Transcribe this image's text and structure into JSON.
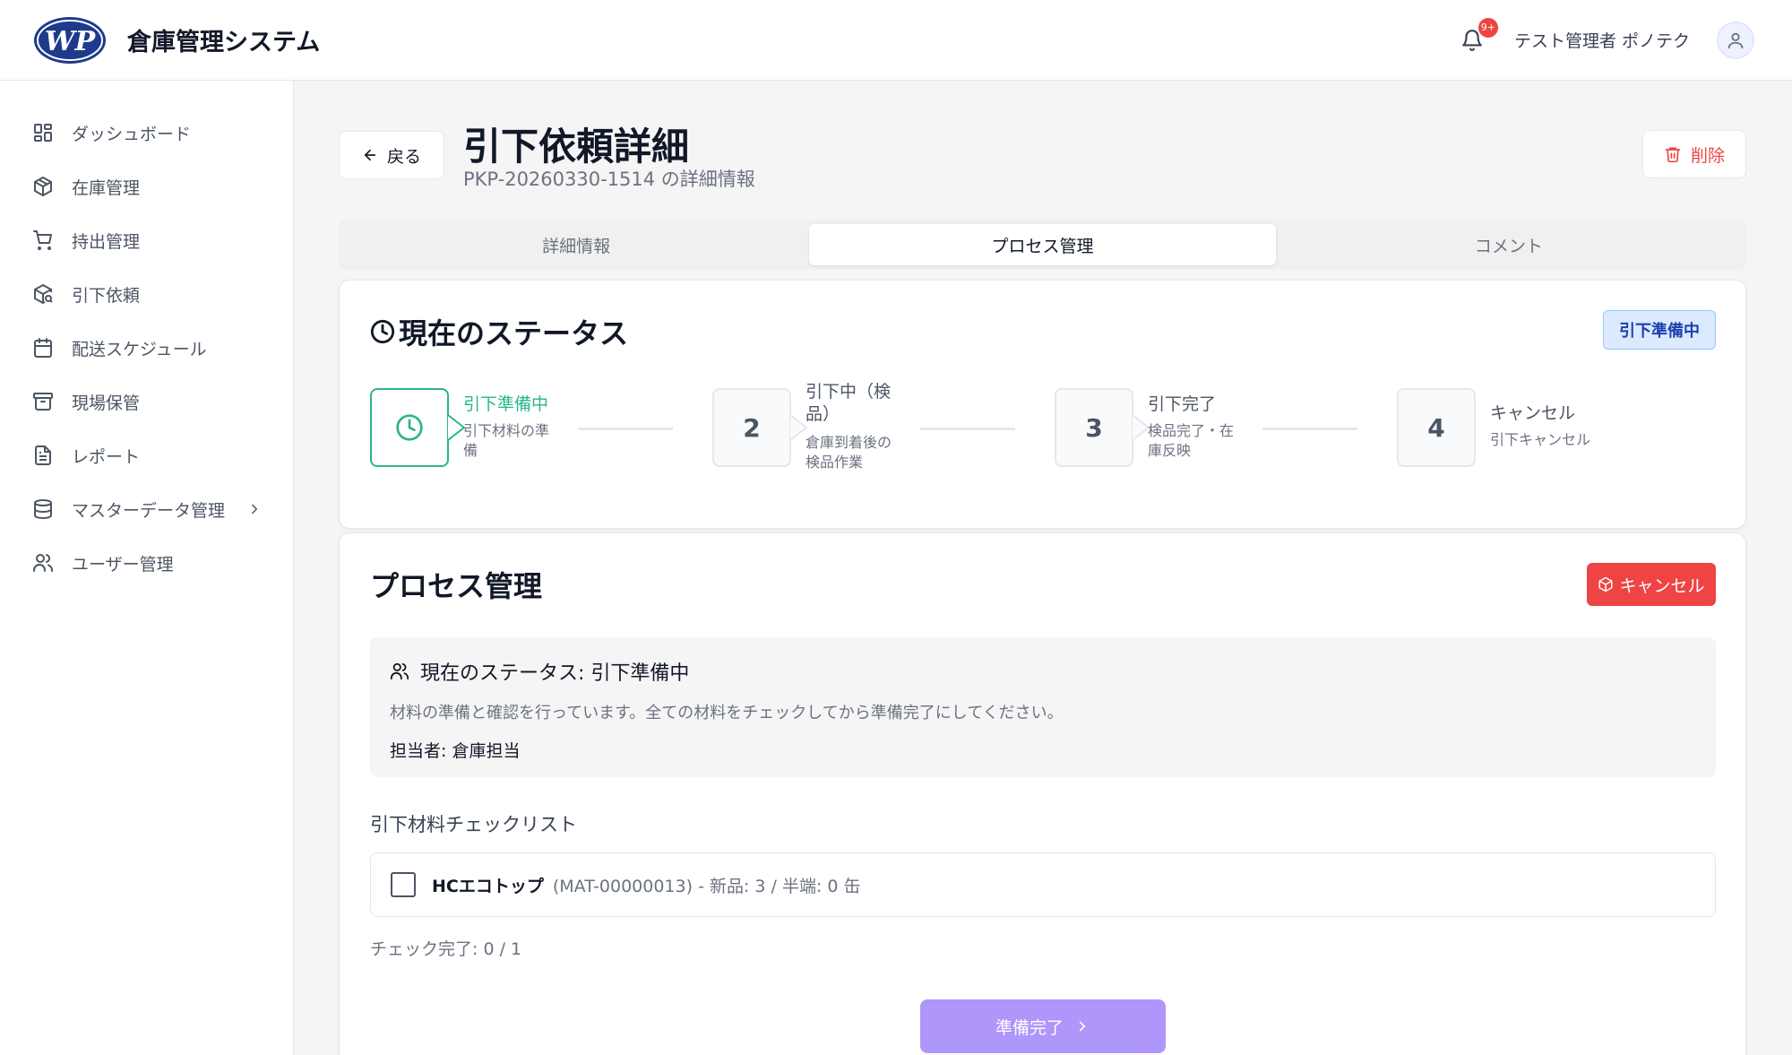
{
  "header": {
    "logo_text": "WP",
    "app_title": "倉庫管理システム",
    "notification_count": "9+",
    "user_name": "テスト管理者 ポノテク"
  },
  "sidebar": {
    "items": [
      {
        "label": "ダッシュボード",
        "icon": "dashboard-icon"
      },
      {
        "label": "在庫管理",
        "icon": "package-icon"
      },
      {
        "label": "持出管理",
        "icon": "cart-icon"
      },
      {
        "label": "引下依頼",
        "icon": "package-search-icon"
      },
      {
        "label": "配送スケジュール",
        "icon": "calendar-icon"
      },
      {
        "label": "現場保管",
        "icon": "archive-icon"
      },
      {
        "label": "レポート",
        "icon": "file-text-icon"
      },
      {
        "label": "マスターデータ管理",
        "icon": "database-icon"
      },
      {
        "label": "ユーザー管理",
        "icon": "users-icon"
      }
    ]
  },
  "page": {
    "back_label": "戻る",
    "title": "引下依頼詳細",
    "subtitle": "PKP-20260330-1514 の詳細情報",
    "delete_label": "削除"
  },
  "tabs": [
    {
      "label": "詳細情報",
      "active": false
    },
    {
      "label": "プロセス管理",
      "active": true
    },
    {
      "label": "コメント",
      "active": false
    }
  ],
  "status_card": {
    "title": "現在のステータス",
    "badge": "引下準備中",
    "steps": [
      {
        "number": "",
        "title": "引下準備中",
        "desc": "引下材料の準備"
      },
      {
        "number": "2",
        "title": "引下中（検品）",
        "desc": "倉庫到着後の検品作業"
      },
      {
        "number": "3",
        "title": "引下完了",
        "desc": "検品完了・在庫反映"
      },
      {
        "number": "4",
        "title": "キャンセル",
        "desc": "引下キャンセル"
      }
    ]
  },
  "process_card": {
    "title": "プロセス管理",
    "cancel_label": "キャンセル",
    "info_title": "現在のステータス: 引下準備中",
    "info_desc": "材料の準備と確認を行っています。全ての材料をチェックしてから準備完了にしてください。",
    "assignee": "担当者: 倉庫担当",
    "checklist_label": "引下材料チェックリスト",
    "items": [
      {
        "name": "HCエコトップ",
        "detail": "(MAT-00000013) - 新品: 3 / 半端: 0 缶",
        "checked": false
      }
    ],
    "progress": "チェック完了: 0 / 1",
    "complete_label": "準備完了"
  },
  "colors": {
    "accent_green": "#2bb58f",
    "danger": "#ef4444",
    "badge_blue": "#1e40af",
    "primary_disabled": "#a78bfa"
  }
}
